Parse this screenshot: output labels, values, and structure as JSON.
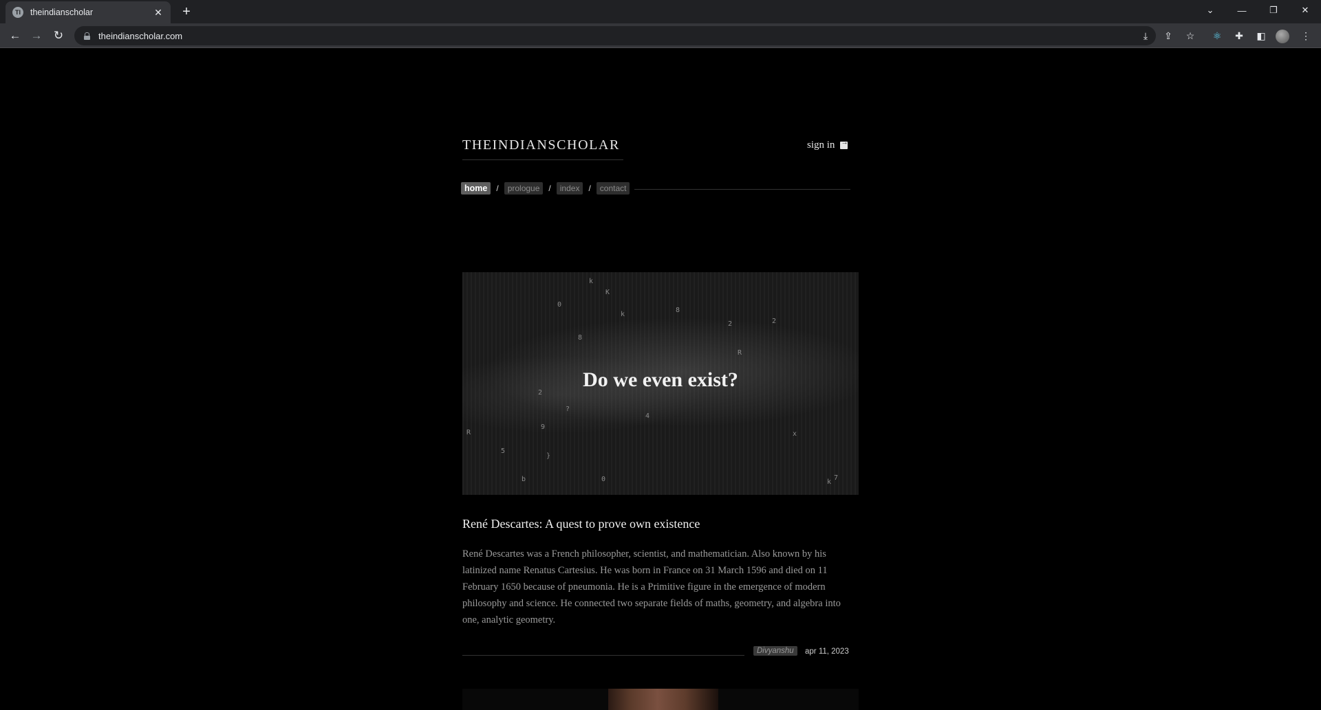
{
  "browser": {
    "tab_title": "theindianscholar",
    "tab_favicon": "TI",
    "new_tab_symbol": "+",
    "url": "theindianscholar.com",
    "icons": [
      "back-icon",
      "forward-icon",
      "reload-icon",
      "lock-icon",
      "install-icon",
      "share-icon",
      "star-icon",
      "react-devtools-icon",
      "extensions-icon",
      "side-panel-icon",
      "profile-avatar",
      "menu-icon"
    ]
  },
  "site": {
    "title": "THEINDIANSCHOLAR",
    "signin_label": "sign in"
  },
  "nav": {
    "items": [
      {
        "label": "home",
        "active": true
      },
      {
        "label": "prologue",
        "active": false
      },
      {
        "label": "index",
        "active": false
      },
      {
        "label": "contact",
        "active": false
      }
    ],
    "separator": "/"
  },
  "post": {
    "image_caption": "Do we even exist?",
    "title": "René Descartes: A quest to prove own existence",
    "excerpt": "René Descartes was a French philosopher, scientist, and mathematician. Also known by his latinized name Renatus Cartesius. He was born in France on 31 March 1596 and died on 11 February 1650 because of pneumonia. He is a Primitive figure in the emergence of modern philosophy and science. He connected two separate fields of maths, geometry, and algebra into one, analytic geometry.",
    "author": "Divyanshu",
    "date": "apr 11, 2023"
  },
  "colors": {
    "page_bg": "#000000",
    "chrome_bg": "#202124",
    "toolbar_bg": "#35363a",
    "nav_active_bg": "#5e5e5e",
    "nav_bg": "#2e2e2e"
  }
}
